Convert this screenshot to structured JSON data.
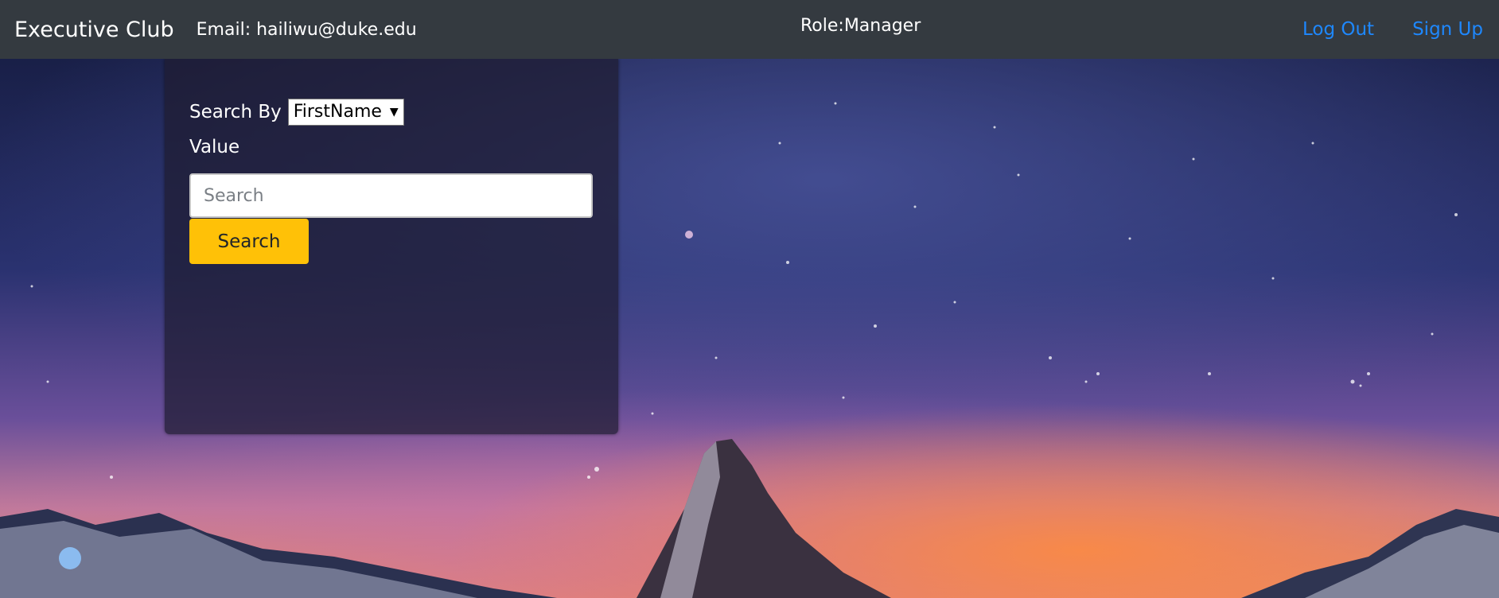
{
  "navbar": {
    "brand": "Executive Club",
    "email_text": "Email: hailiwu@duke.edu",
    "role_text": "Role:Manager",
    "links": [
      {
        "label": "Log Out"
      },
      {
        "label": "Sign Up"
      }
    ]
  },
  "search_panel": {
    "search_by_label": "Search By",
    "search_by_selected": "FirstName",
    "value_label": "Value",
    "input_placeholder": "Search",
    "input_value": "",
    "button_label": "Search"
  },
  "colors": {
    "navbar_bg": "#343a40",
    "link": "#1e88ff",
    "button": "#ffc107"
  },
  "icons": {
    "select_caret": "caret-down-icon"
  }
}
